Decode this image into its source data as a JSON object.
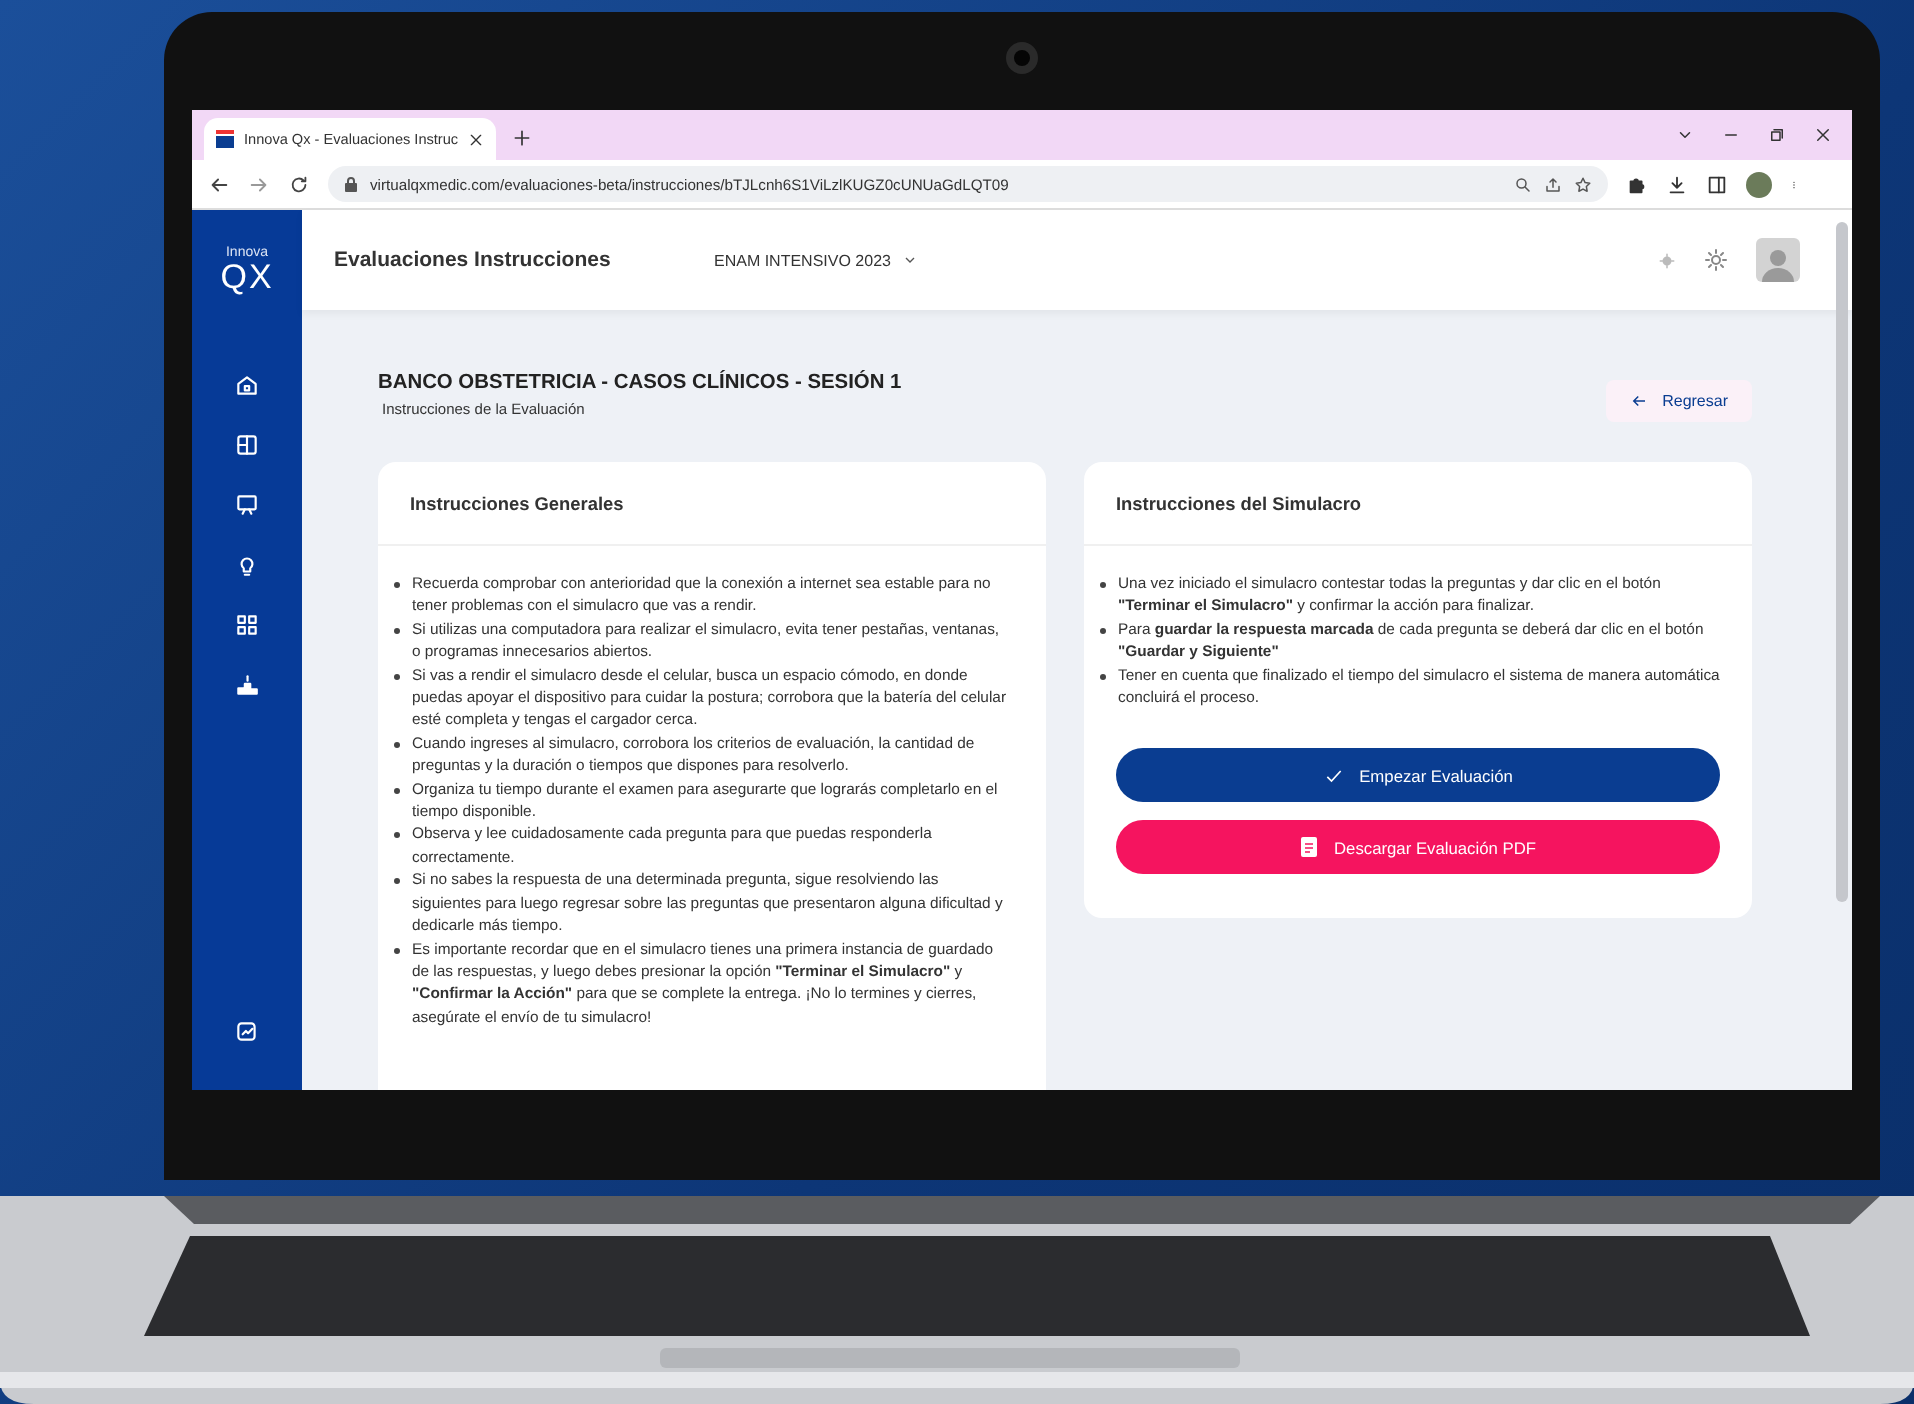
{
  "browser": {
    "tab": {
      "title": "Innova Qx - Evaluaciones Instruc",
      "selected": true
    },
    "url": "virtualqxmedic.com/evaluaciones-beta/instrucciones/bTJLcnh6S1ViLzlKUGZ0cUNUaGdLQT09"
  },
  "sidebar": {
    "logo": {
      "line_1": "Innova",
      "line_2": "QX"
    }
  },
  "header": {
    "title": "Evaluaciones Instrucciones",
    "course_select": "ENAM INTENSIVO 2023"
  },
  "page": {
    "title": "BANCO OBSTETRICIA - CASOS CLÍNICOS - SESIÓN 1",
    "subtitle": "Instrucciones de la Evaluación",
    "back_button": "Regresar"
  },
  "general_card": {
    "title": "Instrucciones Generales",
    "items": [
      "Recuerda comprobar con anterioridad que la conexión a internet sea estable para no tener problemas con el simulacro que vas a rendir.",
      "Si utilizas una computadora para realizar el simulacro, evita tener pestañas, ventanas, o programas innecesarios abiertos.",
      "Si vas a rendir el simulacro desde el celular, busca un espacio cómodo, en donde puedas apoyar el dispositivo para cuidar la postura; corrobora que la batería del celular esté completa y tengas el cargador cerca.",
      "Cuando ingreses al simulacro, corrobora los criterios de evaluación, la cantidad de preguntas y la duración o tiempos que dispones para resolverlo.",
      "Organiza tu tiempo durante el examen para asegurarte que lograrás completarlo en el tiempo disponible.",
      "Observa y lee cuidadosamente cada pregunta para que puedas responderla correctamente.",
      "Si no sabes la respuesta de una determinada pregunta, sigue resolviendo las siguientes para luego regresar sobre las preguntas que presentaron alguna dificultad y dedicarle más tiempo.",
      "Es importante recordar que en el simulacro tienes una primera instancia de guardado de las respuestas, y luego debes presionar la opción **\"Terminar el Simulacro\"** y **\"Confirmar la Acción\"** para que se complete la entrega. ¡No lo termines y cierres, asegúrate el envío de tu simulacro!"
    ]
  },
  "simulation_card": {
    "title": "Instrucciones del Simulacro",
    "items": [
      "Una vez iniciado el simulacro contestar todas la preguntas y dar clic en el botón **\"Terminar el Simulacro\"** y confirmar la acción para finalizar.",
      "Para **guardar la respuesta marcada** de cada pregunta se deberá dar clic en el botón **\"Guardar y Siguiente\"**",
      "Tener en cuenta que finalizado el tiempo del simulacro el sistema de manera automática concluirá el proceso."
    ],
    "buttons": [
      {
        "label": "Empezar Evaluación",
        "kind": "start"
      },
      {
        "label": "Descargar Evaluación PDF",
        "kind": "download"
      }
    ]
  }
}
